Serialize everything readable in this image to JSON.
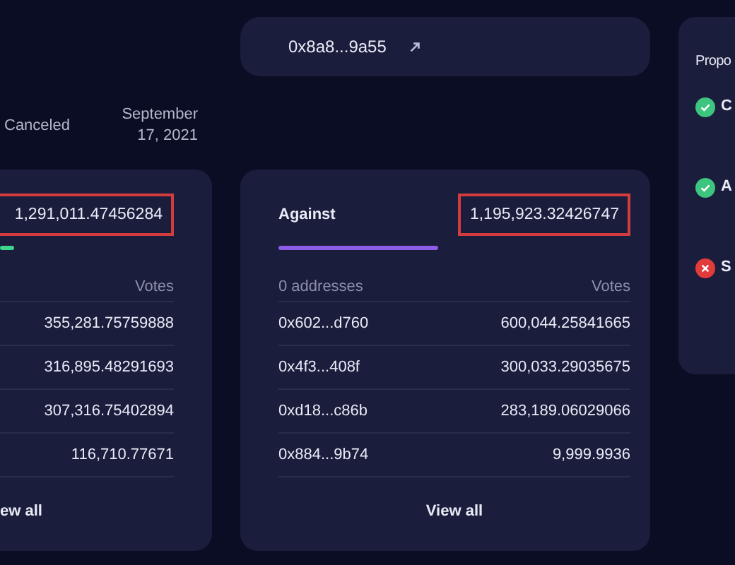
{
  "status": {
    "label": "Canceled",
    "date_line1": "September",
    "date_line2": "17, 2021"
  },
  "proposer": {
    "address": "0x8a8...9a55"
  },
  "for_card": {
    "total": "1,291,011.47456284",
    "votes_header": "Votes",
    "rows": [
      "355,281.75759888",
      "316,895.48291693",
      "307,316.75402894",
      "116,710.77671"
    ],
    "view_all": "ew all"
  },
  "against_card": {
    "label": "Against",
    "total": "1,195,923.32426747",
    "addresses_header": "0 addresses",
    "votes_header": "Votes",
    "rows": [
      {
        "address": "0x602...d760",
        "votes": "600,044.25841665"
      },
      {
        "address": "0x4f3...408f",
        "votes": "300,033.29035675"
      },
      {
        "address": "0xd18...c86b",
        "votes": "283,189.06029066"
      },
      {
        "address": "0x884...9b74",
        "votes": "9,999.9936"
      }
    ],
    "view_all": "View all"
  },
  "history": {
    "title": "Propo",
    "items": [
      {
        "title": "C",
        "passed": true
      },
      {
        "title": "A",
        "passed": true
      },
      {
        "title": "S",
        "passed": false
      }
    ]
  }
}
